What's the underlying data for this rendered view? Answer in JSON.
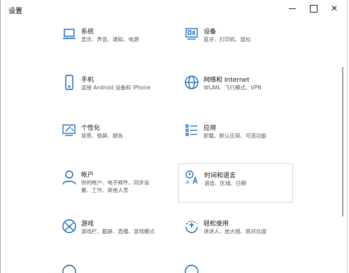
{
  "window": {
    "title": "设置"
  },
  "categories": [
    {
      "title": "系统",
      "desc": "显示、声音、通知、电源"
    },
    {
      "title": "设备",
      "desc": "蓝牙、打印机、鼠标"
    },
    {
      "title": "手机",
      "desc": "连接 Android 设备和 iPhone"
    },
    {
      "title": "网络和 Internet",
      "desc": "WLAN、飞行模式、VPN"
    },
    {
      "title": "个性化",
      "desc": "背景、锁屏、颜色"
    },
    {
      "title": "应用",
      "desc": "卸载、默认应用、可选功能"
    },
    {
      "title": "帐户",
      "desc": "你的帐户、电子邮件、同步设置、工作、其他人员"
    },
    {
      "title": "时间和语言",
      "desc": "语音、区域、日期"
    },
    {
      "title": "游戏",
      "desc": "游戏栏、截屏、直播、游戏模式"
    },
    {
      "title": "轻松使用",
      "desc": "讲述人、放大镜、高对比度"
    }
  ],
  "colors": {
    "accent": "#0a64b4"
  }
}
